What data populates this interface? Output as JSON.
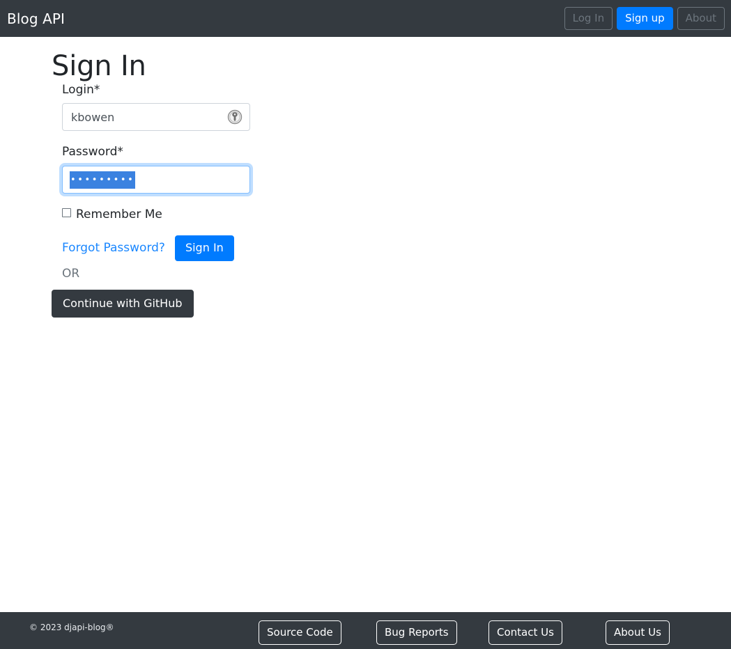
{
  "navbar": {
    "brand": "Blog API",
    "buttons": [
      {
        "label": "Log In",
        "name": "log-in-button",
        "style": "outline"
      },
      {
        "label": "Sign up",
        "name": "sign-up-button",
        "style": "primary"
      },
      {
        "label": "About",
        "name": "about-button",
        "style": "outline"
      }
    ],
    "background_color": "#343a40",
    "primary_color": "#007bff",
    "muted_text_color": "#6c757d"
  },
  "main": {
    "page_title": "Sign In",
    "form": {
      "login": {
        "label": "Login*",
        "value": "kbowen",
        "placeholder": "",
        "icon": "key-icon"
      },
      "password": {
        "label": "Password*",
        "value": "•••••••••",
        "masked_char_count": 9,
        "placeholder": "",
        "focused": true,
        "text_selected": true,
        "selection_color": "#3b82e0",
        "focus_border_color": "#80bdff"
      },
      "remember_me": {
        "label": "Remember Me",
        "checked": false
      },
      "forgot_password_link": "Forgot Password?",
      "submit_label": "Sign In",
      "or_text": "OR",
      "oauth_label": "Continue with GitHub"
    }
  },
  "footer": {
    "copyright": "© 2023 djapi-blog®",
    "background_color": "#343a40",
    "links": [
      {
        "label": "Source Code",
        "name": "source-code-button"
      },
      {
        "label": "Bug Reports",
        "name": "bug-reports-button"
      },
      {
        "label": "Contact Us",
        "name": "contact-us-button"
      },
      {
        "label": "About Us",
        "name": "about-us-button"
      }
    ]
  }
}
